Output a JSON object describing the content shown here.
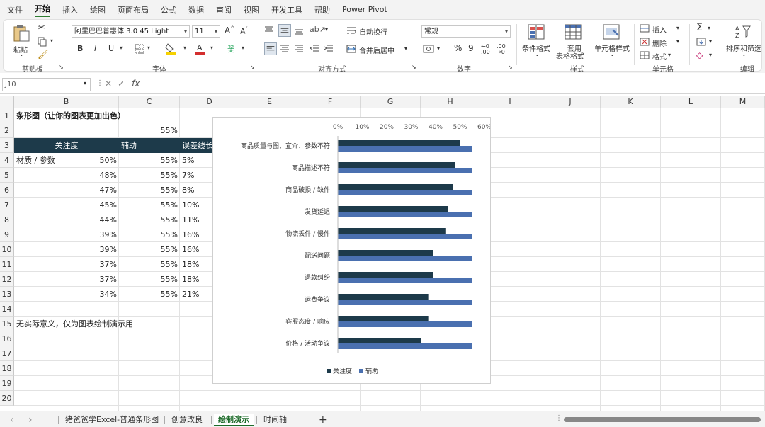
{
  "menu": {
    "tabs": [
      "文件",
      "开始",
      "插入",
      "绘图",
      "页面布局",
      "公式",
      "数据",
      "审阅",
      "视图",
      "开发工具",
      "帮助",
      "Power Pivot"
    ],
    "active": "开始"
  },
  "ribbon": {
    "paste_label": "粘贴",
    "clipboard_group": "剪贴板",
    "font_name": "阿里巴巴普惠体 3.0 45 Light",
    "font_size": "11",
    "font_group": "字体",
    "wrap_text": "自动换行",
    "merge_center": "合并后居中",
    "align_group": "对齐方式",
    "number_format": "常规",
    "number_group": "数字",
    "conditional_format": "条件格式",
    "table_format_line1": "套用",
    "table_format_line2": "表格格式",
    "cell_style": "单元格样式",
    "styles_group": "样式",
    "insert": "插入",
    "delete": "删除",
    "format": "格式",
    "cells_group": "单元格",
    "sort_filter": "排序和筛选",
    "editing_group": "编辑",
    "bold": "B",
    "italic": "I",
    "underline": "U",
    "percent": "%",
    "comma": "9"
  },
  "formula_bar": {
    "name_box": "J10",
    "fx": "fx",
    "value": ""
  },
  "columns": [
    "B",
    "C",
    "D",
    "E",
    "F",
    "G",
    "H",
    "I",
    "J",
    "K",
    "L",
    "M"
  ],
  "rows": [
    "1",
    "2",
    "3",
    "4",
    "5",
    "6",
    "7",
    "8",
    "9",
    "10",
    "11",
    "12",
    "13",
    "14",
    "15",
    "16",
    "17",
    "18",
    "19",
    "20"
  ],
  "sheet": {
    "title": "条形图（让你的图表更加出色）",
    "c2": "55%",
    "headers": {
      "b": "关注度",
      "c": "辅助",
      "d": "误差线长"
    },
    "b4_label": "材质 / 参数",
    "data_rows": [
      {
        "b": "50%",
        "c": "55%",
        "d": "5%"
      },
      {
        "b": "48%",
        "c": "55%",
        "d": "7%"
      },
      {
        "b": "47%",
        "c": "55%",
        "d": "8%"
      },
      {
        "b": "45%",
        "c": "55%",
        "d": "10%"
      },
      {
        "b": "44%",
        "c": "55%",
        "d": "11%"
      },
      {
        "b": "39%",
        "c": "55%",
        "d": "16%"
      },
      {
        "b": "39%",
        "c": "55%",
        "d": "16%"
      },
      {
        "b": "37%",
        "c": "55%",
        "d": "18%"
      },
      {
        "b": "37%",
        "c": "55%",
        "d": "18%"
      },
      {
        "b": "34%",
        "c": "55%",
        "d": "21%"
      }
    ],
    "note": "无实际意义，仅为图表绘制演示用"
  },
  "chart_data": {
    "type": "bar",
    "orientation": "horizontal",
    "categories": [
      "商品质量与图、宣介、参数不符",
      "商品描述不符",
      "商品破损 / 缺件",
      "发货延迟",
      "物流丢件 / 慢件",
      "配送问题",
      "退款纠纷",
      "运费争议",
      "客服态度 / 响应",
      "价格 / 活动争议"
    ],
    "series": [
      {
        "name": "关注度",
        "values": [
          50,
          48,
          47,
          45,
          44,
          39,
          39,
          37,
          37,
          34
        ],
        "color": "#1d3a4a"
      },
      {
        "name": "辅助",
        "values": [
          55,
          55,
          55,
          55,
          55,
          55,
          55,
          55,
          55,
          55
        ],
        "color": "#4a70b0"
      }
    ],
    "xticks": [
      "0%",
      "10%",
      "20%",
      "30%",
      "40%",
      "50%",
      "60%"
    ],
    "xlim": [
      0,
      60
    ],
    "legend": "bottom"
  },
  "sheet_tabs": [
    "猪爸爸学Excel-普通条形图",
    "创意改良",
    "绘制演示",
    "时间轴"
  ],
  "active_tab": "绘制演示",
  "nav": {
    "prev": "‹",
    "next": "›",
    "add": "+"
  }
}
